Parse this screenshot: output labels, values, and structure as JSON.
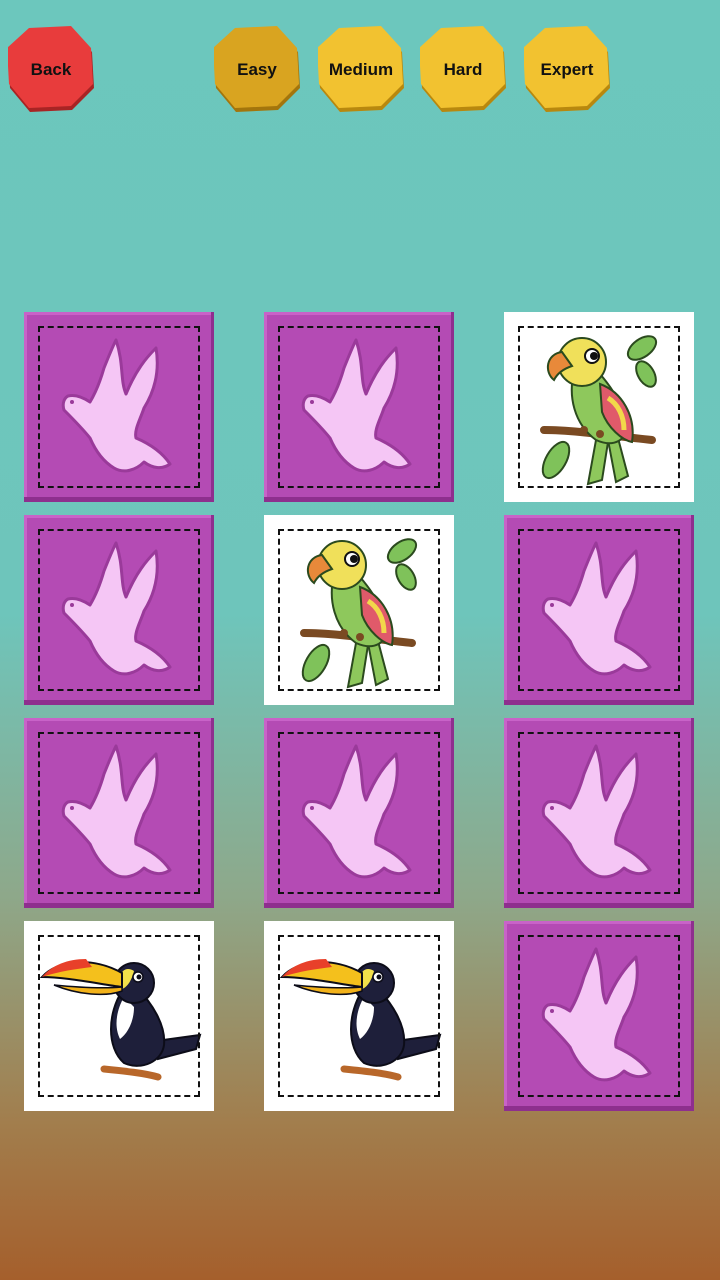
{
  "buttons": {
    "back": "Back",
    "easy": "Easy",
    "medium": "Medium",
    "hard": "Hard",
    "expert": "Expert"
  },
  "board": {
    "rows": 4,
    "cols": 3,
    "cards": [
      {
        "state": "hidden"
      },
      {
        "state": "hidden"
      },
      {
        "state": "revealed",
        "image": "parrot"
      },
      {
        "state": "hidden"
      },
      {
        "state": "revealed",
        "image": "parrot"
      },
      {
        "state": "hidden"
      },
      {
        "state": "hidden"
      },
      {
        "state": "hidden"
      },
      {
        "state": "hidden"
      },
      {
        "state": "revealed",
        "image": "toucan"
      },
      {
        "state": "revealed",
        "image": "toucan"
      },
      {
        "state": "hidden"
      }
    ]
  },
  "colors": {
    "card_back": "#b44bb4",
    "dove": "#f5c6f5",
    "back_button": "#e83c3c",
    "level_button": "#f2c230"
  }
}
